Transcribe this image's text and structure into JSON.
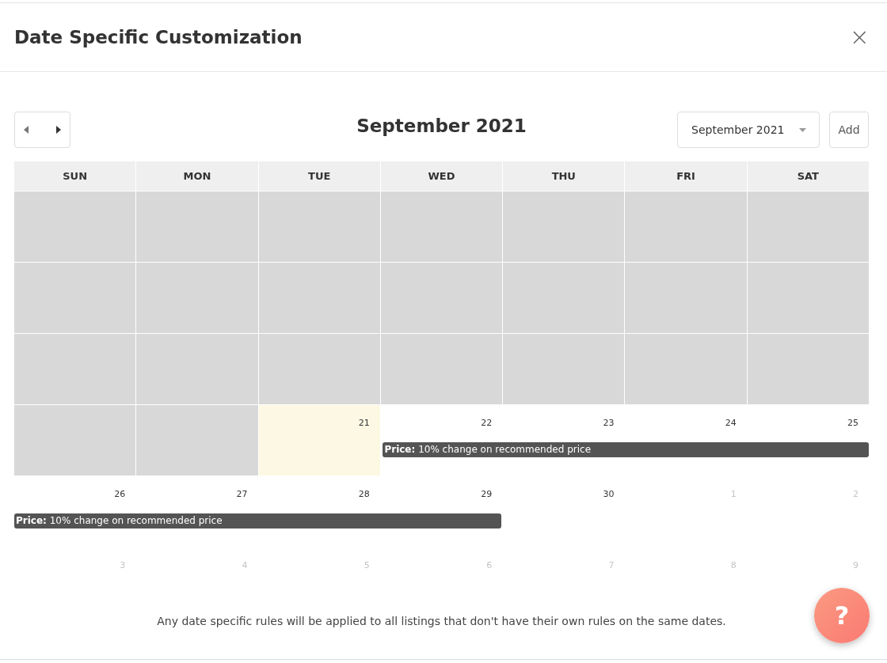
{
  "dialog": {
    "title": "Date Specific Customization",
    "close": "×"
  },
  "toolbar": {
    "month_title": "September 2021",
    "month_select": "September 2021",
    "add_button": "Add"
  },
  "weekdays": [
    "SUN",
    "MON",
    "TUE",
    "WED",
    "THU",
    "FRI",
    "SAT"
  ],
  "weeks": [
    {
      "days": [
        {
          "kind": "disabled"
        },
        {
          "kind": "disabled"
        },
        {
          "kind": "disabled"
        },
        {
          "kind": "disabled"
        },
        {
          "kind": "disabled"
        },
        {
          "kind": "disabled"
        },
        {
          "kind": "disabled"
        }
      ]
    },
    {
      "days": [
        {
          "kind": "disabled"
        },
        {
          "kind": "disabled"
        },
        {
          "kind": "disabled"
        },
        {
          "kind": "disabled"
        },
        {
          "kind": "disabled"
        },
        {
          "kind": "disabled"
        },
        {
          "kind": "disabled"
        }
      ]
    },
    {
      "days": [
        {
          "kind": "disabled"
        },
        {
          "kind": "disabled"
        },
        {
          "kind": "disabled"
        },
        {
          "kind": "disabled"
        },
        {
          "kind": "disabled"
        },
        {
          "kind": "disabled"
        },
        {
          "kind": "disabled"
        }
      ]
    },
    {
      "days": [
        {
          "kind": "disabled"
        },
        {
          "kind": "disabled"
        },
        {
          "kind": "today",
          "date": "21"
        },
        {
          "kind": "current",
          "date": "22",
          "event": "**Price:** 10% change on recommended price"
        },
        {
          "kind": "current",
          "date": "23",
          "covered": true
        },
        {
          "kind": "current",
          "date": "24",
          "covered": true
        },
        {
          "kind": "current",
          "date": "25",
          "covered": true
        }
      ]
    },
    {
      "days": [
        {
          "kind": "current",
          "date": "26",
          "event": "**Price:** 10% change on recommended price"
        },
        {
          "kind": "current",
          "date": "27",
          "covered": true
        },
        {
          "kind": "current",
          "date": "28",
          "covered": true
        },
        {
          "kind": "current",
          "date": "29",
          "covered": true
        },
        {
          "kind": "current",
          "date": "30"
        },
        {
          "kind": "other",
          "date": "1"
        },
        {
          "kind": "other",
          "date": "2"
        }
      ]
    },
    {
      "days": [
        {
          "kind": "other",
          "date": "3"
        },
        {
          "kind": "other",
          "date": "4"
        },
        {
          "kind": "other",
          "date": "5"
        },
        {
          "kind": "other",
          "date": "6"
        },
        {
          "kind": "other",
          "date": "7"
        },
        {
          "kind": "other",
          "date": "8"
        },
        {
          "kind": "other",
          "date": "9"
        }
      ]
    }
  ],
  "footer_note": "Any date specific rules will be applied to all listings that don't have their own rules on the same dates.",
  "help_button": "?"
}
